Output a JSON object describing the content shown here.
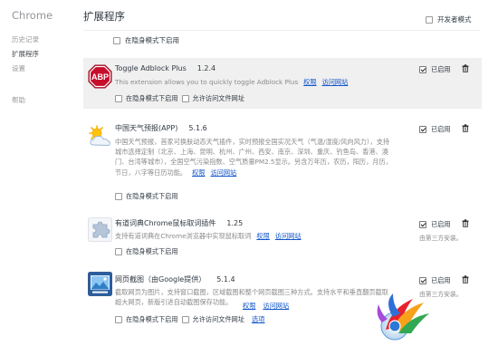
{
  "sidebar": {
    "brand": "Chrome",
    "items": [
      "历史记录",
      "扩展程序",
      "设置",
      "帮助"
    ]
  },
  "header": {
    "title": "扩展程序",
    "developer_mode": "开发者模式"
  },
  "top_option": {
    "incognito": "在隐身模式下启用"
  },
  "extensions": [
    {
      "name": "Toggle Adblock Plus",
      "version": "1.2.4",
      "description": "This extension allows you to quickly toggle Adblock Plus",
      "links": [
        "权限",
        "访问网站"
      ],
      "incognito": "在隐身模式下启用",
      "file_access": "允许访问文件网址",
      "enabled_label": "已启用"
    },
    {
      "name": "中国天气预报(APP)",
      "version": "5.1.6",
      "description_lines": [
        "中国天气预报，首家可换肤动态天气插件，实时预报全国实况天气（气温/湿度/风向风力），支持",
        "城市选择定制（北京、上海、昆明、杭州、广州、西安、南京、深圳、重庆、钓鱼岛、香港、澳",
        "门、台湾等城市），全国空气污染指数、空气质量PM2.5显示。另含万年历，农历，阳历，月历，",
        "节日，八字等日历功能。"
      ],
      "links": [
        "权限",
        "访问网站"
      ],
      "incognito": "在隐身模式下启用",
      "enabled_label": "已启用"
    },
    {
      "name": "有道词典Chrome鼠标取词插件",
      "version": "1.25",
      "description": "支持有道词典在Chrome浏览器中实现鼠标取词",
      "links": [
        "权限",
        "访问网站"
      ],
      "incognito": "在隐身模式下启用",
      "enabled_label": "已启用",
      "installed_by": "由第三方安装。"
    },
    {
      "name": "网页截图（由Google提供）",
      "version": "5.1.4",
      "description_lines": [
        "截取网页为图片，支持窗口截图，区域截图和整个网页截图三种方式。支持水平和垂直翻页截取",
        "超大网页，新版引进自动截图保存功能。"
      ],
      "links": [
        "权限",
        "访问网站"
      ],
      "incognito": "在隐身模式下启用",
      "file_access": "允许访问文件网址",
      "options": "选项",
      "enabled_label": "已启用",
      "installed_by": "由第三方安装。"
    }
  ],
  "colors": {
    "link": "#1155cc",
    "abp_red": "#c70d2c",
    "text": "#303942",
    "muted": "#8a8a8a"
  }
}
